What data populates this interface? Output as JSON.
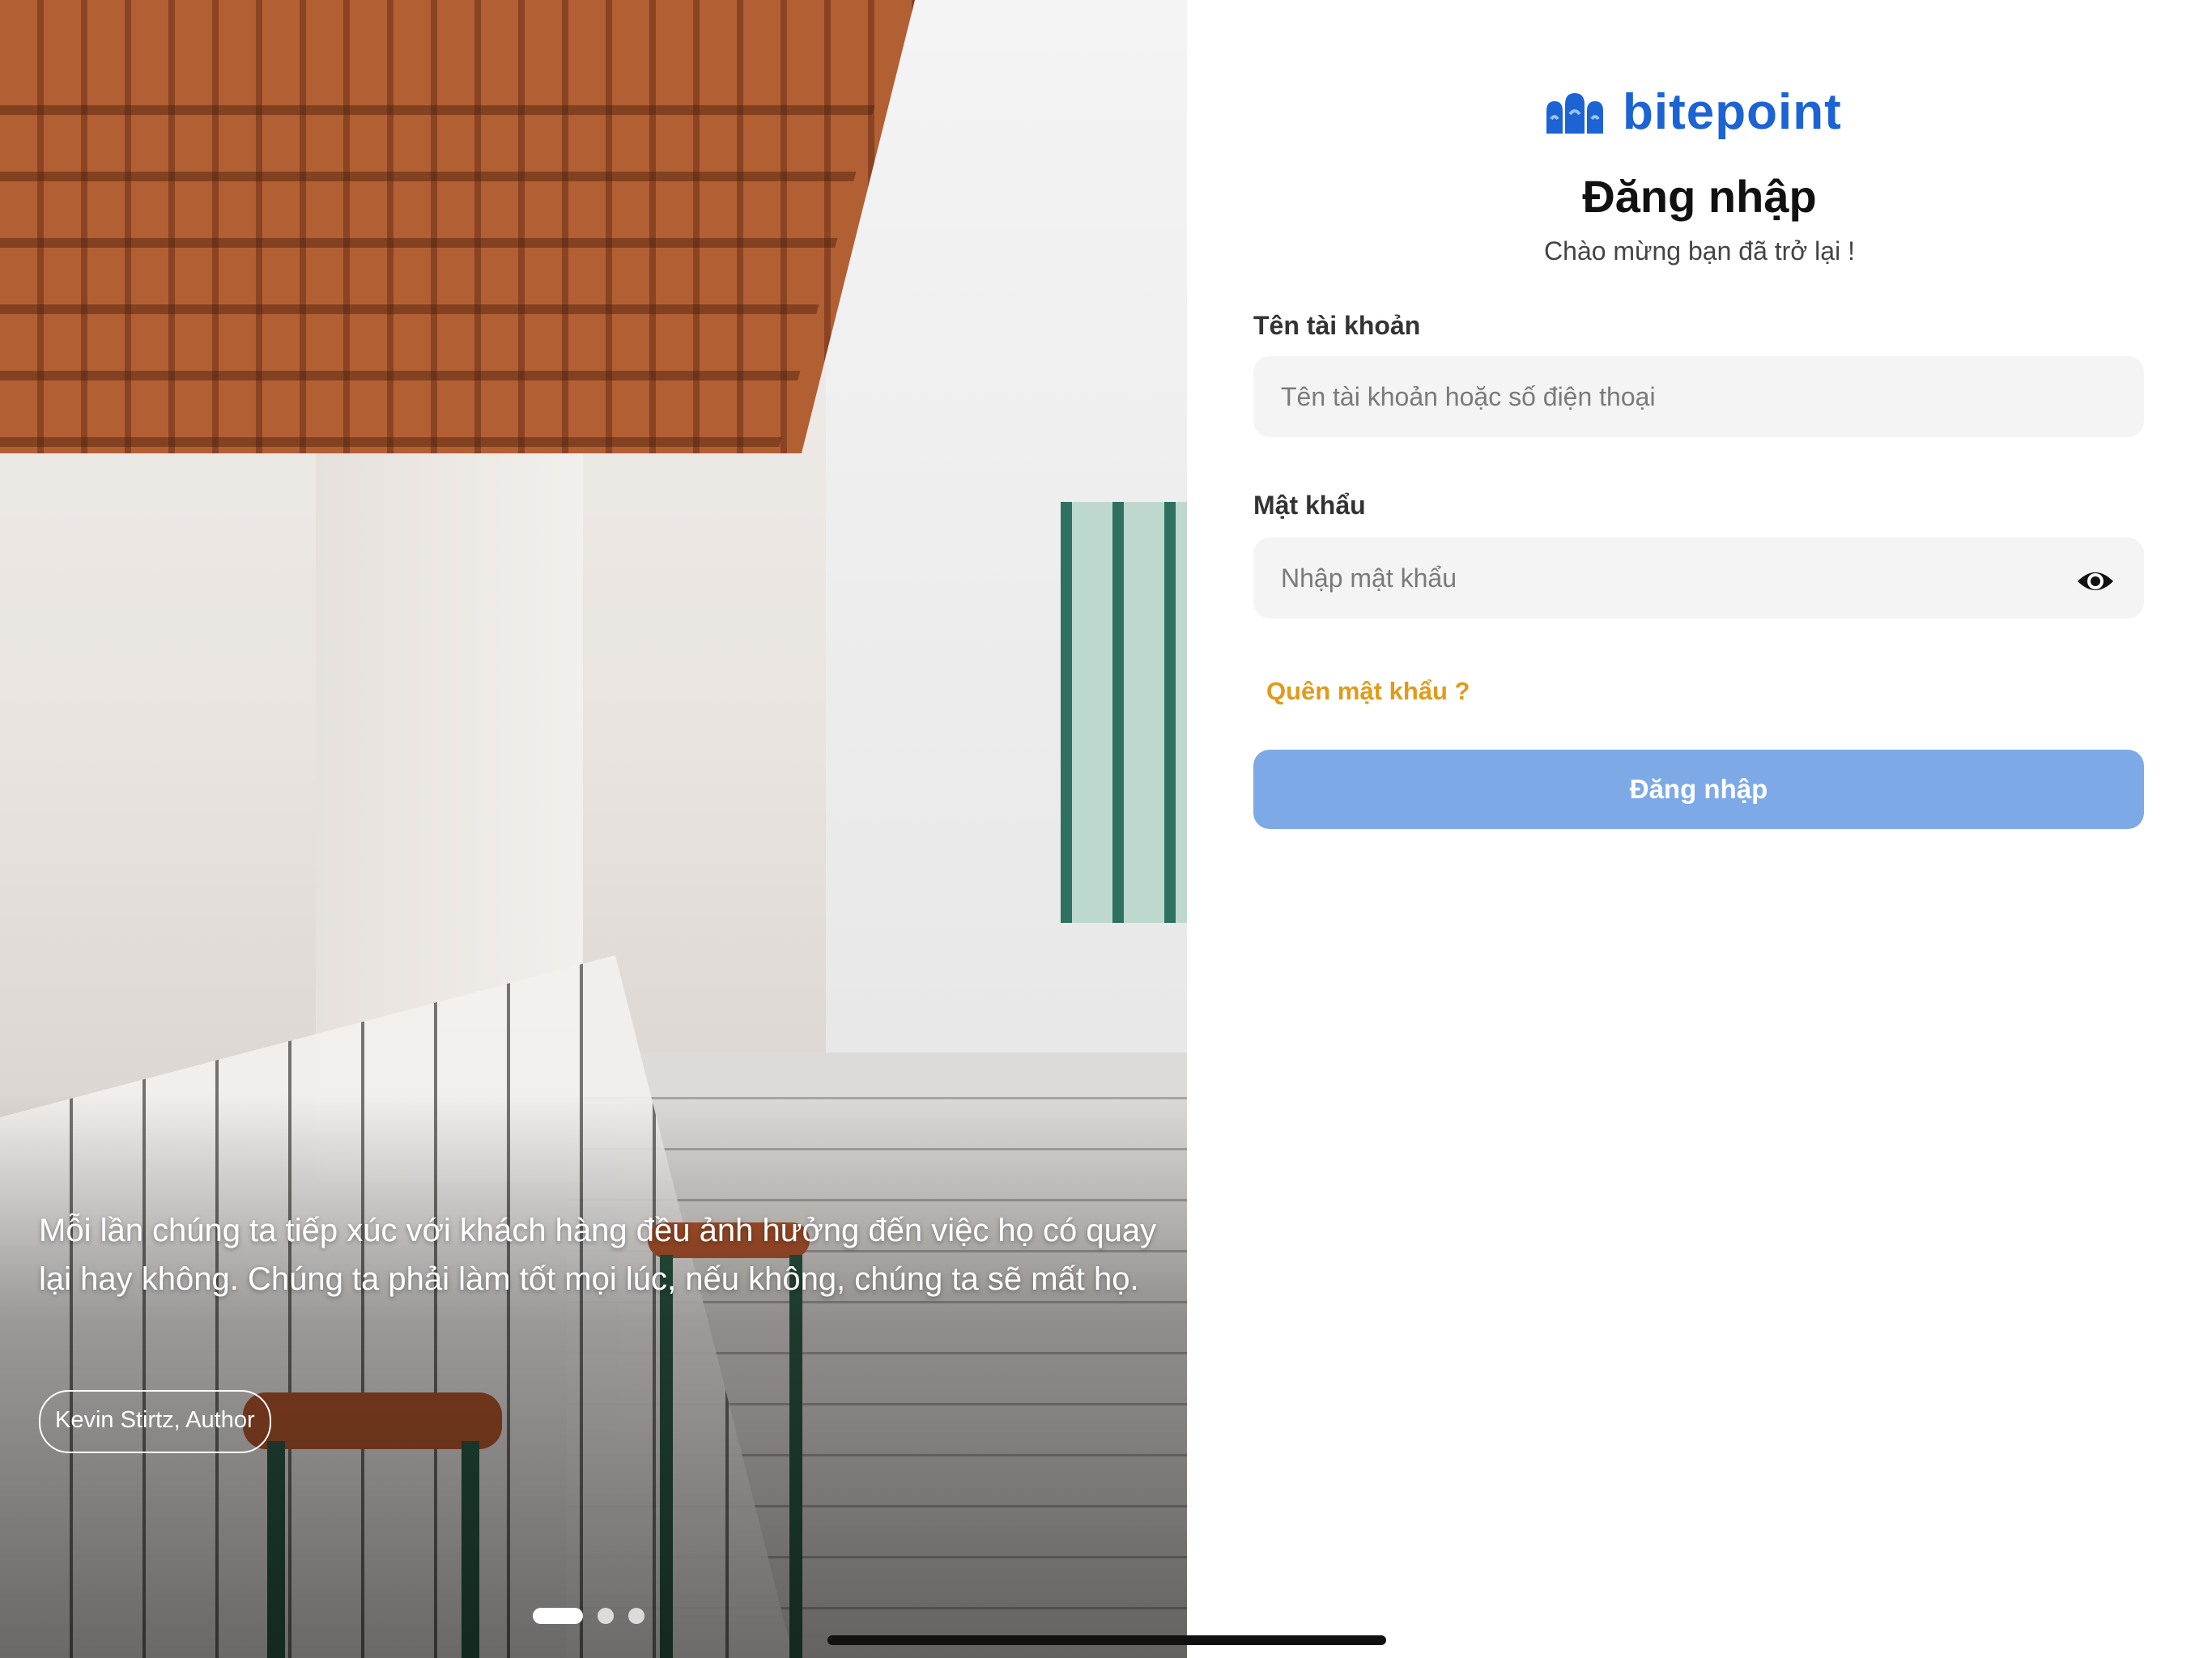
{
  "hero": {
    "quote": "Mỗi lần chúng ta tiếp xúc với khách hàng đều ảnh hưởng đến việc họ có quay lại hay không. Chúng ta phải làm tốt mọi lúc, nếu không, chúng ta sẽ mất họ.",
    "author": "Kevin Stirtz, Author",
    "carousel": {
      "slide_count": 3,
      "active_index": 0
    }
  },
  "brand": {
    "name": "bitepoint",
    "logo_icon": "bitepoint-logo-icon",
    "color": "#1c63d4"
  },
  "login": {
    "title": "Đăng nhập",
    "subtitle": "Chào mừng bạn đã trở lại !",
    "username_label": "Tên tài khoản",
    "username_placeholder": "Tên tài khoản hoặc số điện thoại",
    "username_value": "",
    "password_label": "Mật khẩu",
    "password_placeholder": "Nhập mật khẩu",
    "password_value": "",
    "show_password_icon": "eye-icon",
    "forgot_password": "Quên mật khẩu ?",
    "submit_label": "Đăng nhập"
  },
  "colors": {
    "accent": "#e19a1a",
    "button_disabled": "#7daae6",
    "input_bg": "#f4f4f4"
  }
}
